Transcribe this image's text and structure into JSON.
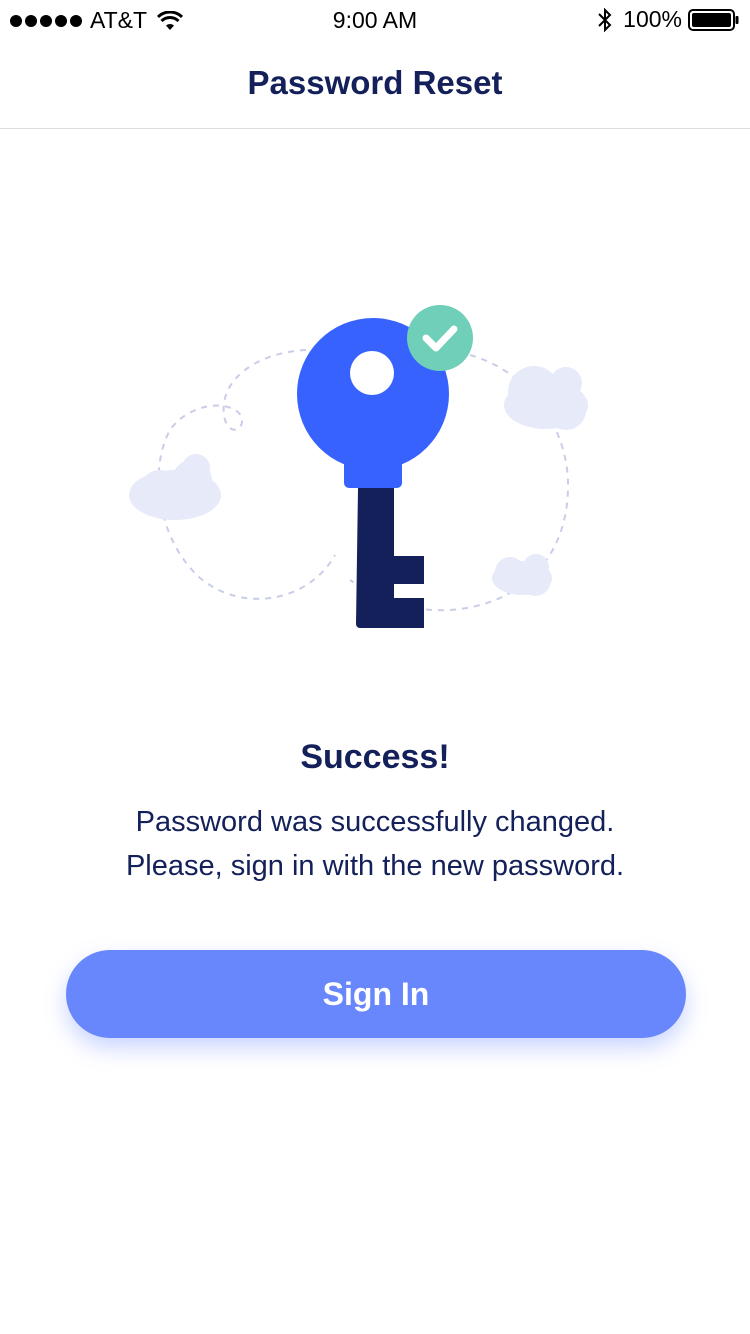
{
  "status_bar": {
    "carrier": "AT&T",
    "time": "9:00 AM",
    "battery_percent": "100%",
    "signal_bars": 5
  },
  "nav": {
    "title": "Password Reset"
  },
  "illustration": {
    "icons": [
      "key-icon",
      "check-icon",
      "cloud-icon"
    ],
    "colors": {
      "key_head": "#3862fe",
      "key_shaft": "#13205a",
      "check_badge": "#6fcfb8",
      "cloud": "#e7eaf8",
      "dashed_path": "#c9cde8"
    }
  },
  "content": {
    "title": "Success!",
    "message_lines": [
      "Password was successfully changed.",
      "Please, sign in with the new password."
    ]
  },
  "actions": {
    "sign_in_label": "Sign In"
  },
  "colors": {
    "primary_text": "#13205a",
    "button_bg": "#6887fc",
    "button_text": "#ffffff"
  }
}
